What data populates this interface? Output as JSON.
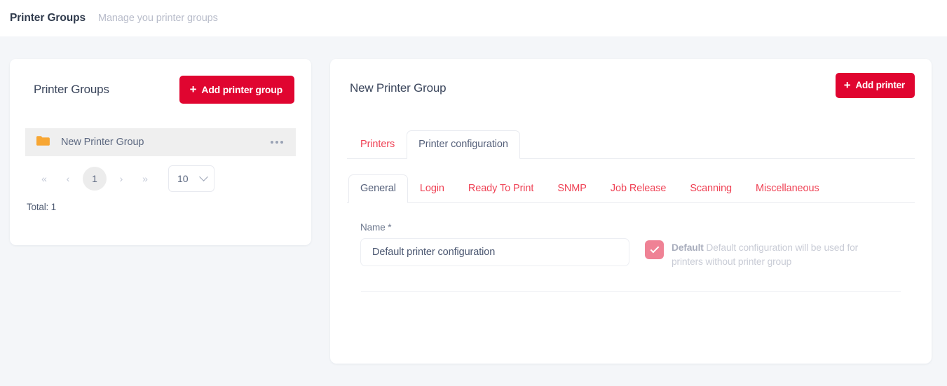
{
  "header": {
    "title": "Printer Groups",
    "subtitle": "Manage you printer groups"
  },
  "colors": {
    "accent_red": "#e00530",
    "tab_red": "#ef4255",
    "checkbox_pink": "#ef8295",
    "folder_orange": "#f7a633",
    "page_bg": "#f4f6f9"
  },
  "left_panel": {
    "title": "Printer Groups",
    "add_button_label": "Add printer group",
    "groups": [
      {
        "name": "New Printer Group",
        "icon": "folder-icon",
        "menu_icon": "more-options-icon"
      }
    ],
    "pagination": {
      "first_label": "«",
      "prev_label": "‹",
      "current_page": "1",
      "next_label": "›",
      "last_label": "»",
      "page_size": "10"
    },
    "total_label": "Total: 1"
  },
  "right_panel": {
    "title": "New Printer Group",
    "add_button_label": "Add printer",
    "tabs": [
      {
        "label": "Printers",
        "active": false
      },
      {
        "label": "Printer configuration",
        "active": true
      }
    ],
    "sub_tabs": [
      {
        "label": "General",
        "active": true
      },
      {
        "label": "Login",
        "active": false
      },
      {
        "label": "Ready To Print",
        "active": false
      },
      {
        "label": "SNMP",
        "active": false
      },
      {
        "label": "Job Release",
        "active": false
      },
      {
        "label": "Scanning",
        "active": false
      },
      {
        "label": "Miscellaneous",
        "active": false
      }
    ],
    "form": {
      "name_label": "Name *",
      "name_value": "Default printer configuration",
      "name_placeholder": "Name",
      "default_checkbox": {
        "checked": true,
        "strong_label": "Default",
        "description": "Default configuration will be used for printers without printer group"
      }
    }
  }
}
